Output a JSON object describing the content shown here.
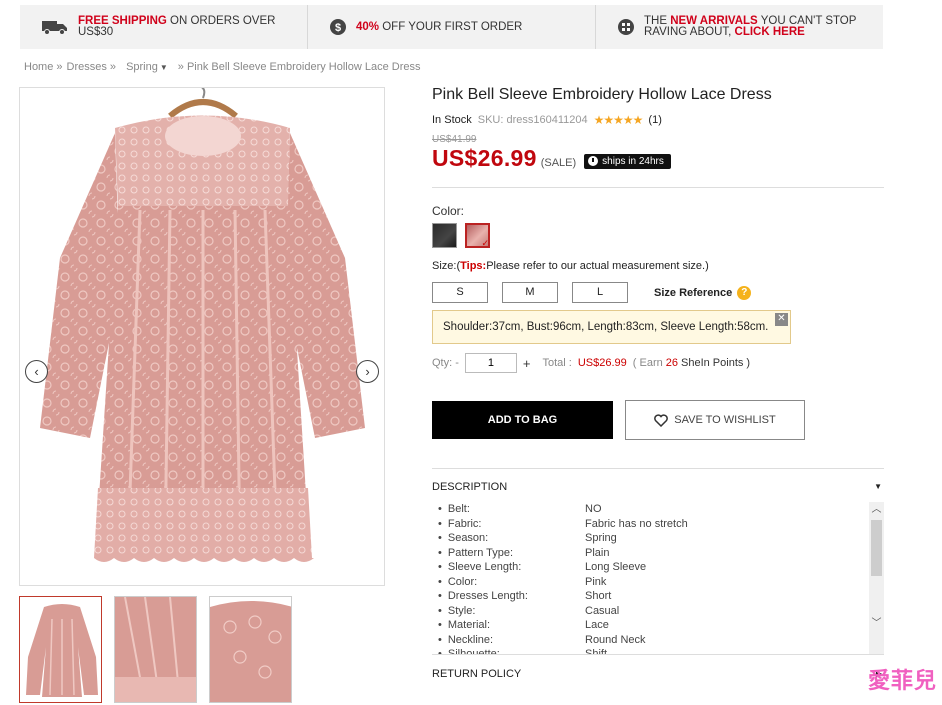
{
  "promo": {
    "shipping": {
      "highlight": "FREE SHIPPING",
      "text": " ON ORDERS OVER",
      "text2": "US$30"
    },
    "discount": {
      "highlight": "40%",
      "text": " OFF YOUR FIRST ORDER"
    },
    "arrivals": {
      "pre": "THE ",
      "highlight": "NEW ARRIVALS",
      "text": " YOU CAN'T STOP",
      "text2": "RAVING ABOUT, ",
      "link": "CLICK HERE"
    }
  },
  "breadcrumb": [
    "Home »",
    "Dresses »",
    "Spring",
    "» Pink Bell Sleeve Embroidery Hollow Lace Dress"
  ],
  "product": {
    "title": "Pink Bell Sleeve Embroidery Hollow Lace Dress",
    "stock": "In Stock",
    "sku": "SKU: dress160411204",
    "stars": "★★★★★",
    "reviews": "(1)",
    "old_price": "US$41.99",
    "price": "US$26.99",
    "sale": "(SALE)",
    "ships": "ships in 24hrs"
  },
  "color_label": "Color:",
  "colors": [
    "black",
    "pink"
  ],
  "size": {
    "label": "Size:",
    "tips_open": "(",
    "tips": "Tips:",
    "tips_text": "Please refer to our actual measurement size.)",
    "options": [
      "S",
      "M",
      "L"
    ],
    "reference": "Size Reference",
    "measure": "Shoulder:37cm, Bust:96cm, Length:83cm, Sleeve Length:58cm."
  },
  "qty": {
    "label": "Qty: -",
    "value": "1",
    "plus": "+",
    "total_label": "Total :",
    "total": "US$26.99",
    "earn_pre": "( Earn",
    "earn_pts": "26",
    "earn_post": "SheIn Points )"
  },
  "buttons": {
    "add": "ADD TO BAG",
    "wish": "SAVE TO WISHLIST"
  },
  "description": {
    "title": "DESCRIPTION",
    "specs": [
      {
        "k": "Belt:",
        "v": "NO"
      },
      {
        "k": "Fabric:",
        "v": "Fabric has no stretch"
      },
      {
        "k": "Season:",
        "v": "Spring"
      },
      {
        "k": "Pattern Type:",
        "v": "Plain"
      },
      {
        "k": "Sleeve Length:",
        "v": "Long Sleeve"
      },
      {
        "k": "Color:",
        "v": "Pink"
      },
      {
        "k": "Dresses Length:",
        "v": "Short"
      },
      {
        "k": "Style:",
        "v": "Casual"
      },
      {
        "k": "Material:",
        "v": "Lace"
      },
      {
        "k": "Neckline:",
        "v": "Round Neck"
      },
      {
        "k": "Silhouette:",
        "v": "Shift"
      }
    ]
  },
  "return_policy": "RETURN POLICY",
  "watermark": "愛菲兒",
  "colors_theme": {
    "accent": "#c0070e",
    "dress": "#dca19b"
  }
}
